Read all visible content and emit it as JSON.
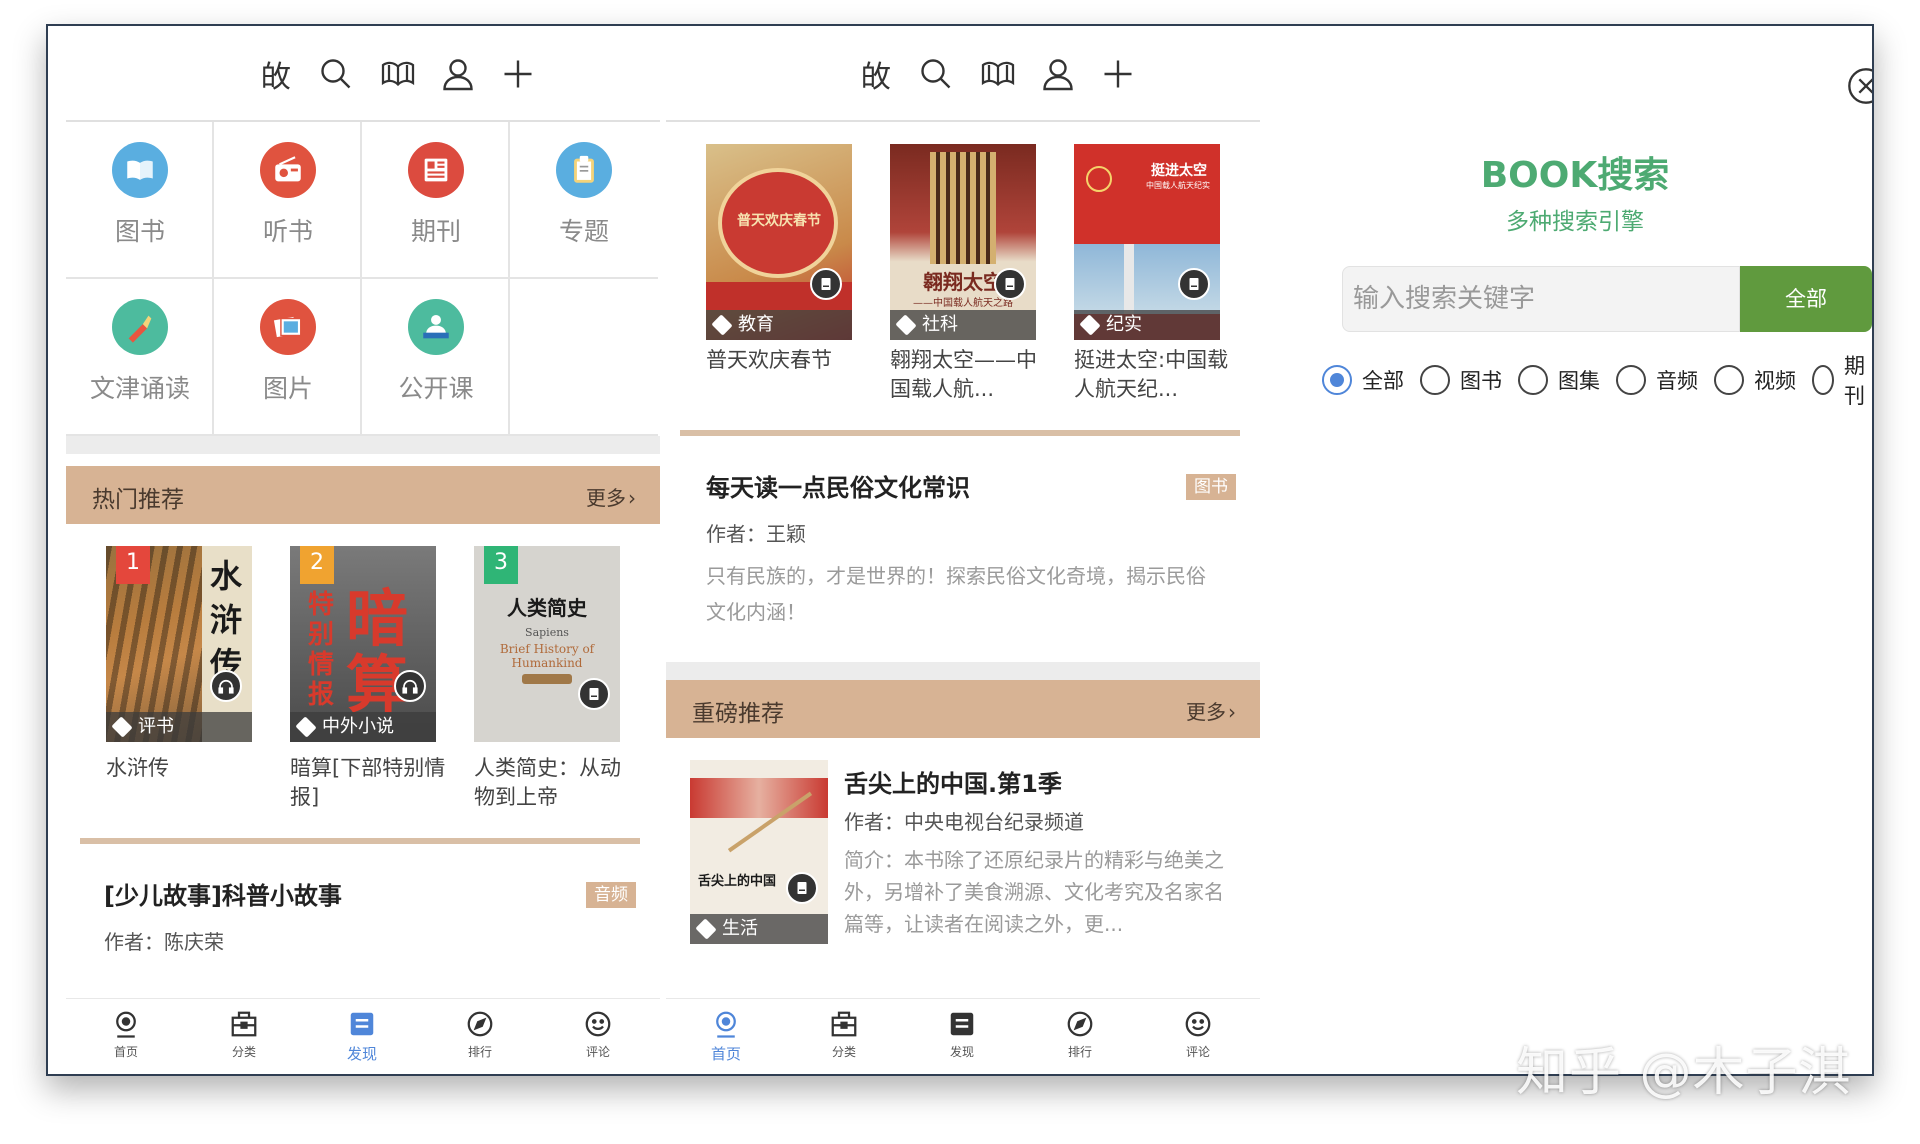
{
  "topbar_icons": [
    "text-icon",
    "search-icon",
    "book-icon",
    "user-icon",
    "plus-icon"
  ],
  "text_icon_glyph": "敀",
  "categories": [
    {
      "label": "图书",
      "color": "#5aaee0",
      "icon": "book-icon"
    },
    {
      "label": "听书",
      "color": "#e0533f",
      "icon": "radio-icon"
    },
    {
      "label": "期刊",
      "color": "#dc4b3f",
      "icon": "newspaper-icon"
    },
    {
      "label": "专题",
      "color": "#5aaee0",
      "icon": "clipboard-icon"
    },
    {
      "label": "文津诵读",
      "color": "#4dbb9e",
      "icon": "brush-icon"
    },
    {
      "label": "图片",
      "color": "#e0533f",
      "icon": "photo-icon"
    },
    {
      "label": "公开课",
      "color": "#4dbb9e",
      "icon": "teacher-icon"
    }
  ],
  "hot": {
    "title": "热门推荐",
    "more": "更多",
    "books": [
      {
        "rank": "1",
        "rank_color": "#e4473c",
        "tag": "评书",
        "title": "水浒传",
        "cover_title": "水浒传",
        "badge": "headphones-icon"
      },
      {
        "rank": "2",
        "rank_color": "#f0a330",
        "tag": "中外小说",
        "title": "暗算[下部特别情报]",
        "cover_title": "特别情报暗算",
        "badge": "headphones-icon"
      },
      {
        "rank": "3",
        "rank_color": "#2fb576",
        "tag": "",
        "title": "人类简史：从动物到上帝",
        "cover_title": "人类简史",
        "cover_sub": "Sapiens",
        "cover_sub2": "Brief History of Humankind",
        "badge": "reader-icon"
      }
    ]
  },
  "list_item_1": {
    "title": "[少儿故事]科普小故事",
    "tag": "音频",
    "author": "作者：陈庆荣"
  },
  "p2_books": [
    {
      "tag": "教育",
      "title": "普天欢庆春节",
      "cover_title": "普天欢庆春节"
    },
    {
      "tag": "社科",
      "title": "翱翔太空——中国载人航...",
      "cover_title": "翱翔太空",
      "cover_sub": "——中国载人航天之路"
    },
    {
      "tag": "纪实",
      "title": "挺进太空:中国载人航天纪...",
      "cover_title": "挺进太空",
      "cover_sub": "中国载人航天纪实"
    }
  ],
  "p2_item": {
    "title": "每天读一点民俗文化常识",
    "tag": "图书",
    "author": "作者：王颖",
    "desc": "只有民族的，才是世界的！探索民俗文化奇境，揭示民俗文化内涵！"
  },
  "heavy": {
    "title": "重磅推荐",
    "more": "更多",
    "book": {
      "title": "舌尖上的中国.第1季",
      "author": "作者：中央电视台纪录频道",
      "desc": "简介：本书除了还原纪录片的精彩与绝美之外，另增补了美食溯源、文化考究及名家名篇等，让读者在阅读之外，更...",
      "tag": "生活",
      "cover_title": "舌尖上的中国"
    }
  },
  "nav": [
    {
      "label": "首页",
      "icon": "home-icon"
    },
    {
      "label": "分类",
      "icon": "category-icon"
    },
    {
      "label": "发现",
      "icon": "discover-icon"
    },
    {
      "label": "排行",
      "icon": "rank-icon"
    },
    {
      "label": "评论",
      "icon": "comment-icon"
    }
  ],
  "nav_active": {
    "p1": 2,
    "p2": 0
  },
  "accent_color": "#4f86d9",
  "search": {
    "title": "BOOK搜索",
    "subtitle": "多种搜索引擎",
    "placeholder": "输入搜索关键字",
    "button": "全部",
    "options": [
      "全部",
      "图书",
      "图集",
      "音频",
      "视频",
      "期刊"
    ],
    "selected": 0
  },
  "watermark": "知乎 @木子淇"
}
